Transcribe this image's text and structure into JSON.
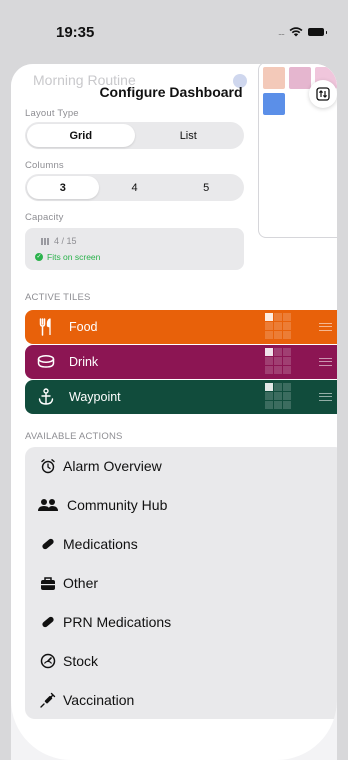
{
  "status": {
    "time": "19:35",
    "signal_dots": "....",
    "wifi": "wifi-icon",
    "battery": "battery-icon"
  },
  "background": {
    "title": "Morning Routine"
  },
  "header": {
    "title": "Configure Dashboard",
    "swap_icon": "swap-vertical-icon"
  },
  "layout_type": {
    "label": "Layout Type",
    "options": [
      "Grid",
      "List"
    ],
    "selected": "Grid"
  },
  "columns": {
    "label": "Columns",
    "options": [
      "3",
      "4",
      "5"
    ],
    "selected": "3"
  },
  "capacity": {
    "label": "Capacity",
    "count": "4 / 15",
    "status": "Fits on screen"
  },
  "active_tiles": {
    "label": "ACTIVE TILES",
    "items": [
      {
        "label": "Food",
        "icon": "fork-knife-icon",
        "color": "#e8610a"
      },
      {
        "label": "Drink",
        "icon": "cup-icon",
        "color": "#8c1553"
      },
      {
        "label": "Waypoint",
        "icon": "anchor-icon",
        "color": "#114c3c"
      }
    ]
  },
  "available_actions": {
    "label": "AVAILABLE ACTIONS",
    "items": [
      {
        "label": "Alarm Overview",
        "icon": "alarm-clock-icon"
      },
      {
        "label": "Community Hub",
        "icon": "people-icon"
      },
      {
        "label": "Medications",
        "icon": "pill-icon"
      },
      {
        "label": "Other",
        "icon": "toolbox-icon"
      },
      {
        "label": "PRN Medications",
        "icon": "pill-icon"
      },
      {
        "label": "Stock",
        "icon": "gauge-icon"
      },
      {
        "label": "Vaccination",
        "icon": "syringe-icon"
      }
    ]
  },
  "colors": {
    "accent_green": "#2bb24c",
    "preview_tiles": [
      "#f3c9b9",
      "#e5b6cf",
      "#f0c6dc",
      "#5b8fe8"
    ]
  }
}
